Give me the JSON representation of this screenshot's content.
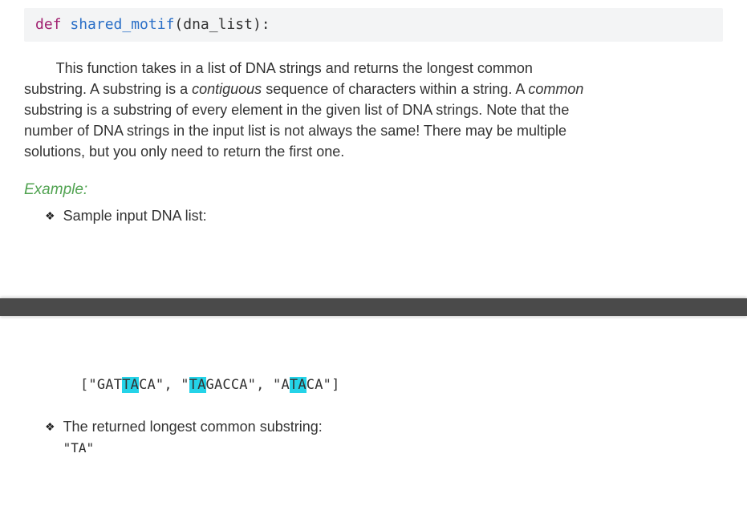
{
  "code": {
    "keyword": "def",
    "funcname": "shared_motif",
    "params": "(dna_list):"
  },
  "paragraph": {
    "line1a": "This function takes in a list of DNA strings and returns the longest common",
    "line2a": "substring. A substring is a ",
    "line2_em": "contiguous",
    "line2b": " sequence of characters within a string. A ",
    "line2_em2": "common",
    "line3": "substring is a substring of every element in the given list of DNA strings. Note that the",
    "line4": "number of DNA strings in the input list is not always the same! There may be multiple",
    "line5": "solutions, but you only need to return the first one."
  },
  "example_label": "Example:",
  "bullet1": "Sample input DNA list:",
  "dna": {
    "open": "[\"GAT",
    "h1": "TA",
    "seg1": "CA\",  \"",
    "h2": "TA",
    "seg2": "GACCA\",  \"A",
    "h3": "TA",
    "seg3": "CA\"]"
  },
  "bullet2": "The returned longest common substring:",
  "result": "\"TA\""
}
